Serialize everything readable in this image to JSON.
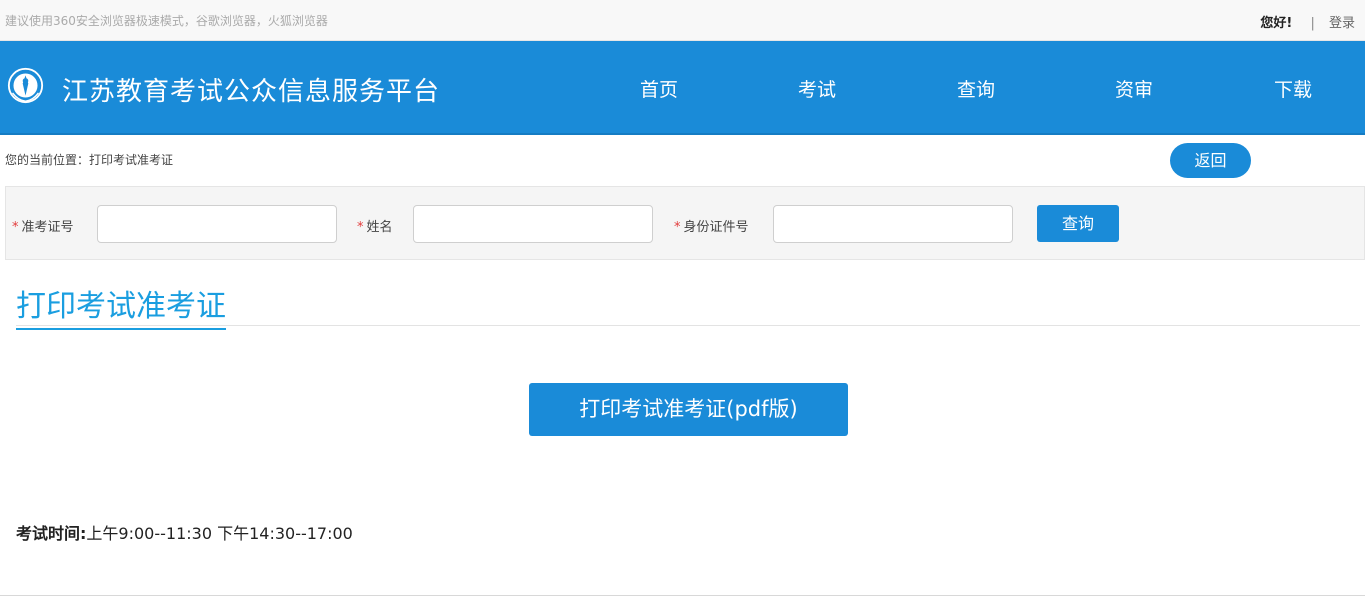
{
  "topbar": {
    "notice": "建议使用360安全浏览器极速模式，谷歌浏览器，火狐浏览器",
    "greeting": "您好!",
    "separator": "|",
    "login": "登录"
  },
  "header": {
    "site_title": "江苏教育考试公众信息服务平台",
    "logo_icon": "education-emblem-icon",
    "nav": [
      "首页",
      "考试",
      "查询",
      "资审",
      "下载"
    ]
  },
  "breadcrumb": {
    "text": "您的当前位置：打印考试准考证",
    "back_label": "返回"
  },
  "search": {
    "required_mark": "*",
    "fields": [
      {
        "label": "准考证号",
        "value": "",
        "placeholder": ""
      },
      {
        "label": "姓名",
        "value": "",
        "placeholder": ""
      },
      {
        "label": "身份证件号",
        "value": "",
        "placeholder": ""
      }
    ],
    "query_label": "查询"
  },
  "main": {
    "section_title": "打印考试准考证",
    "print_button": "打印考试准考证(pdf版)",
    "exam_time_label": "考试时间:",
    "exam_time_value": "上午9:00--11:30 下午14:30--17:00"
  },
  "colors": {
    "brand_blue": "#1a8bd8",
    "title_blue": "#1a9ee0",
    "required_red": "#e23a3a"
  }
}
